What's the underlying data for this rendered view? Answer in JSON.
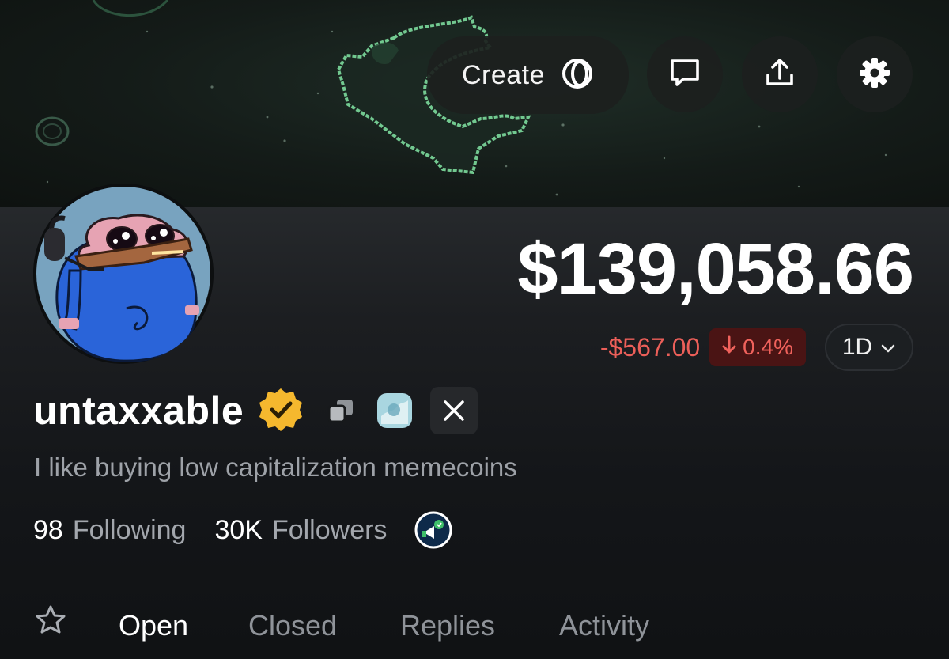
{
  "header": {
    "create_label": "Create",
    "actions": [
      "create-coin-icon",
      "message-icon",
      "share-icon",
      "settings-icon"
    ]
  },
  "profile": {
    "balance": "$139,058.66",
    "change_amount": "-$567.00",
    "change_percent": "0.4%",
    "change_direction_icon": "arrow-down-icon",
    "range": "1D",
    "username": "untaxxable",
    "badges": [
      "verified-badge-icon",
      "copy-icon",
      "linked-app-icon",
      "x-logo-icon"
    ],
    "bio": "I like buying low capitalization memecoins",
    "following_count": "98",
    "following_label": "Following",
    "followers_count": "30K",
    "followers_label": "Followers",
    "community_icon": "community-badge-icon"
  },
  "tabs": [
    {
      "label": "Open",
      "active": true
    },
    {
      "label": "Closed",
      "active": false
    },
    {
      "label": "Replies",
      "active": false
    },
    {
      "label": "Activity",
      "active": false
    }
  ],
  "colors": {
    "background": "#17191b",
    "negative": "#ec5f59",
    "negative_bg": "#4a1414",
    "verified": "#f5b82e",
    "muted_text": "#9ea2a8",
    "banner_accent": "#7fe0a0"
  }
}
